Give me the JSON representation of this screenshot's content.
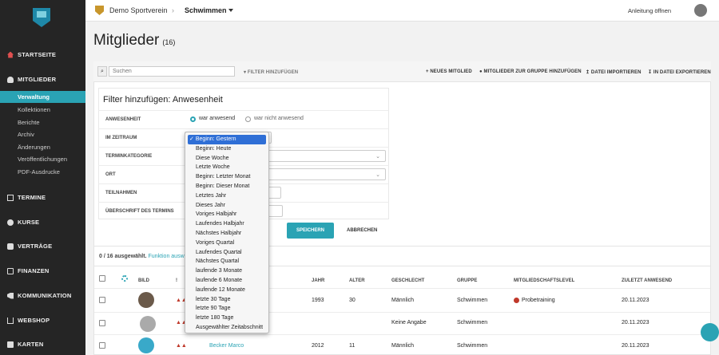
{
  "sidebar": {
    "sections": [
      {
        "label": "STARTSEITE",
        "icon": "home-icon"
      },
      {
        "label": "MITGLIEDER",
        "icon": "group-icon"
      },
      {
        "label": "TERMINE",
        "icon": "calendar-icon"
      },
      {
        "label": "KURSE",
        "icon": "course-icon"
      },
      {
        "label": "VERTRÄGE",
        "icon": "handshake-icon"
      },
      {
        "label": "FINANZEN",
        "icon": "money-icon"
      },
      {
        "label": "KOMMUNIKATION",
        "icon": "megaphone-icon"
      },
      {
        "label": "WEBSHOP",
        "icon": "cart-icon"
      },
      {
        "label": "KARTEN",
        "icon": "card-icon"
      }
    ],
    "subitems": [
      "Verwaltung",
      "Kollektionen",
      "Berichte",
      "Archiv",
      "Änderungen",
      "Veröffentlichungen",
      "PDF-Ausdrucke"
    ]
  },
  "topbar": {
    "club": "Demo Sportverein",
    "separator": "›",
    "group": "Schwimmen",
    "help": "Anleitung öffnen"
  },
  "page": {
    "title": "Mitglieder",
    "count": "(16)"
  },
  "toolbar": {
    "search_placeholder": "Suchen",
    "filter_add": "FILTER HINZUFÜGEN",
    "new_member": "NEUES MITGLIED",
    "add_to_group": "MITGLIEDER ZUR GRUPPE HINZUFÜGEN",
    "import": "DATEI IMPORTIEREN",
    "export": "IN DATEI EXPORTIEREN"
  },
  "filter": {
    "title": "Filter hinzufügen: Anwesenheit",
    "rows": [
      "ANWESENHEIT",
      "IM ZEITRAUM",
      "TERMINKATEGORIE",
      "ORT",
      "TEILNAHMEN",
      "ÜBERSCHRIFT DES TERMINS"
    ],
    "radio_present": "war anwesend",
    "radio_absent": "war nicht anwesend",
    "save": "SPEICHERN",
    "cancel": "ABBRECHEN"
  },
  "dropdown": {
    "options": [
      "Beginn: Gestern",
      "Beginn: Heute",
      "Diese Woche",
      "Letzte Woche",
      "Beginn: Letzter Monat",
      "Beginn: Dieser Monat",
      "Letztes Jahr",
      "Dieses Jahr",
      "Voriges Halbjahr",
      "Laufendes Halbjahr",
      "Nächstes Halbjahr",
      "Voriges Quartal",
      "Laufendes Quartal",
      "Nächstes Quartal",
      "laufende 3 Monate",
      "laufende 6 Monate",
      "laufende 12 Monate",
      "letzte 30 Tage",
      "letzte 90 Tage",
      "letzte 180 Tage",
      "Ausgewählter Zeitabschnitt"
    ],
    "selected_mark": "✓"
  },
  "table": {
    "selection": "0 / 16 ausgewählt.",
    "function_link": "Funktion ausw",
    "headers": {
      "bild": "BILD",
      "excl": "!",
      "jahr": "JAHR",
      "alter": "ALTER",
      "geschlecht": "GESCHLECHT",
      "gruppe": "GRUPPE",
      "level": "MITGLIEDSCHAFTSLEVEL",
      "zuletzt": "ZULETZT ANWESEND"
    },
    "rows": [
      {
        "name": "",
        "jahr": "1993",
        "alter": "30",
        "geschlecht": "Männlich",
        "gruppe": "Schwimmen",
        "level": "Probetraining",
        "zuletzt": "20.11.2023"
      },
      {
        "name": "",
        "jahr": "",
        "alter": "",
        "geschlecht": "Keine Angabe",
        "gruppe": "Schwimmen",
        "level": "",
        "zuletzt": "20.11.2023"
      },
      {
        "name": "Becker Marco",
        "jahr": "2012",
        "alter": "11",
        "geschlecht": "Männlich",
        "gruppe": "Schwimmen",
        "level": "",
        "zuletzt": "20.11.2023"
      }
    ]
  },
  "colors": {
    "accent": "#2aa3b4",
    "sidebar": "#252525",
    "level_dot": "#c0392b",
    "warn": "#c0392b"
  }
}
